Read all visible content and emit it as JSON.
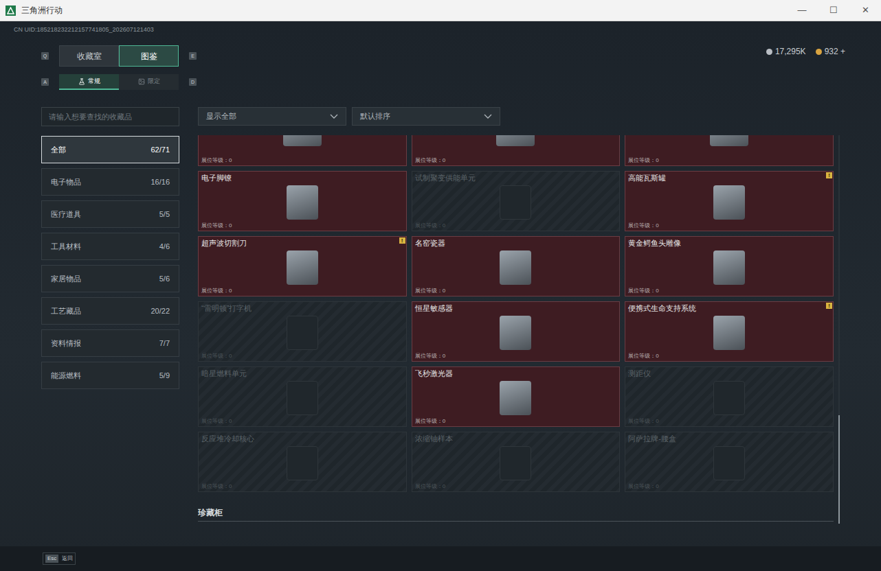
{
  "window": {
    "title": "三角洲行动",
    "controls": [
      "—",
      "☐",
      "✕"
    ]
  },
  "uid": "CN UID:185218232212157741805_202607121403",
  "tabs": {
    "prev_key": "Q",
    "next_key": "E",
    "items": [
      {
        "label": "收藏室",
        "selected": false
      },
      {
        "label": "图鉴",
        "selected": true
      }
    ]
  },
  "subtabs": {
    "prev_key": "A",
    "next_key": "D",
    "items": [
      {
        "label": "常规",
        "selected": true
      },
      {
        "label": "限定",
        "selected": false
      }
    ]
  },
  "currency": [
    {
      "amount": "17,295K",
      "color": "#b9bec4"
    },
    {
      "amount": "932 +",
      "color": "#d9a441"
    }
  ],
  "search": {
    "placeholder": "请输入想要查找的收藏品"
  },
  "filters": [
    {
      "label": "显示全部"
    },
    {
      "label": "默认排序"
    }
  ],
  "sidebar": {
    "items": [
      {
        "label": "全部",
        "count": "62/71",
        "selected": true
      },
      {
        "label": "电子物品",
        "count": "16/16",
        "selected": false
      },
      {
        "label": "医疗道具",
        "count": "5/5",
        "selected": false
      },
      {
        "label": "工具材料",
        "count": "4/6",
        "selected": false
      },
      {
        "label": "家居物品",
        "count": "5/6",
        "selected": false
      },
      {
        "label": "工艺藏品",
        "count": "20/22",
        "selected": false
      },
      {
        "label": "资料情报",
        "count": "7/7",
        "selected": false
      },
      {
        "label": "能源燃料",
        "count": "5/9",
        "selected": false
      }
    ]
  },
  "grid": {
    "partial_row": [
      {
        "level": "展位等级：0",
        "collected": true
      },
      {
        "level": "展位等级：0",
        "collected": true
      },
      {
        "level": "展位等级：0",
        "collected": true
      }
    ],
    "items": [
      {
        "name": "电子脚镣",
        "collected": true,
        "badge": "",
        "level": "展位等级：0"
      },
      {
        "name": "试制聚变供能单元",
        "collected": false,
        "badge": "",
        "level": "展位等级：0"
      },
      {
        "name": "高能瓦斯罐",
        "collected": true,
        "badge": "!",
        "level": "展位等级：0"
      },
      {
        "name": "超声波切割刀",
        "collected": true,
        "badge": "!",
        "level": "展位等级：0"
      },
      {
        "name": "名窑瓷器",
        "collected": true,
        "badge": "",
        "level": "展位等级：0"
      },
      {
        "name": "黄金鳄鱼头雕像",
        "collected": true,
        "badge": "",
        "level": "展位等级：0"
      },
      {
        "name": "“雷明顿”打字机",
        "collected": false,
        "badge": "",
        "level": "展位等级：0"
      },
      {
        "name": "恒星敏感器",
        "collected": true,
        "badge": "",
        "level": "展位等级：0"
      },
      {
        "name": "便携式生命支持系统",
        "collected": true,
        "badge": "!",
        "level": "展位等级：0"
      },
      {
        "name": "暗星燃料单元",
        "collected": false,
        "badge": "",
        "level": "展位等级：0"
      },
      {
        "name": "飞秒激光器",
        "collected": true,
        "badge": "",
        "level": "展位等级：0"
      },
      {
        "name": "测距仪",
        "collected": false,
        "badge": "",
        "level": "展位等级：0"
      },
      {
        "name": "反应堆冷却核心",
        "collected": false,
        "badge": "",
        "level": "展位等级：0"
      },
      {
        "name": "浓缩铀样本",
        "collected": false,
        "badge": "",
        "level": "展位等级：0"
      },
      {
        "name": "阿萨拉牌-腰盒",
        "collected": false,
        "badge": "",
        "level": "展位等级：0"
      }
    ]
  },
  "section": {
    "title": "珍藏柜",
    "cards": [
      {
        "collected": true
      },
      {
        "collected": false
      }
    ]
  },
  "scrollbar": {
    "level": 0.28
  },
  "footer": {
    "key": "Esc",
    "label": "返回"
  }
}
